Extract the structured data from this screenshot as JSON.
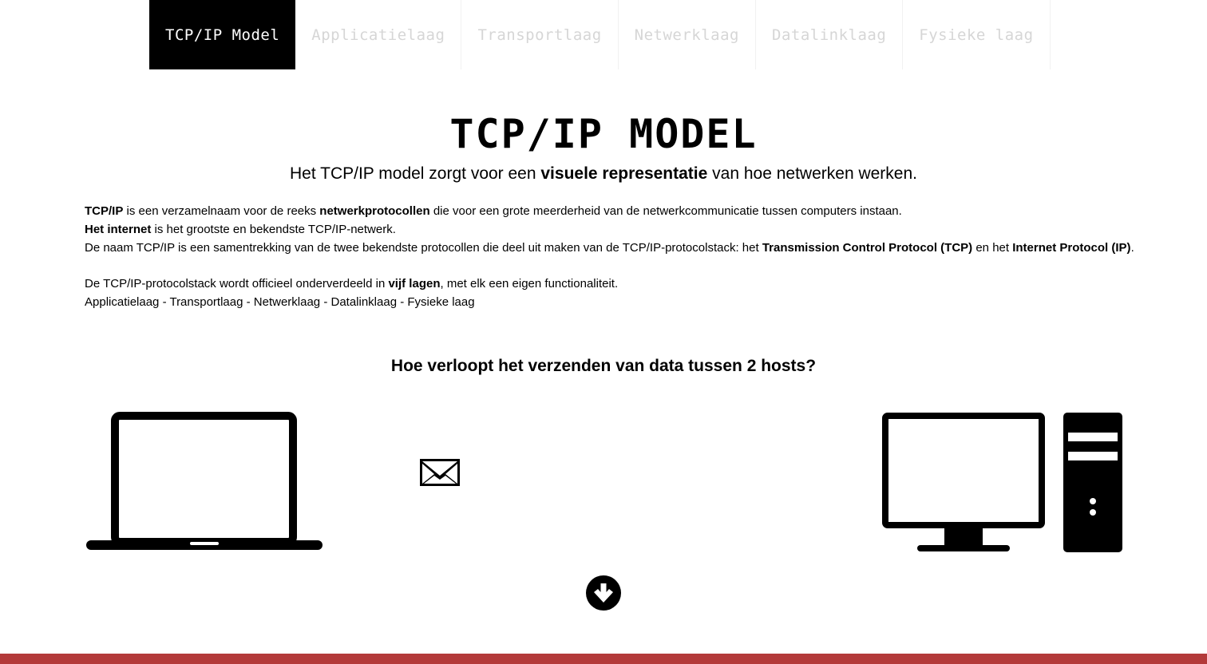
{
  "nav": {
    "items": [
      {
        "label": "TCP/IP Model",
        "active": true
      },
      {
        "label": "Applicatielaag",
        "active": false
      },
      {
        "label": "Transportlaag",
        "active": false
      },
      {
        "label": "Netwerklaag",
        "active": false
      },
      {
        "label": "Datalinklaag",
        "active": false
      },
      {
        "label": "Fysieke laag",
        "active": false
      }
    ]
  },
  "hero": {
    "title": "TCP/IP MODEL",
    "sub_pre": "Het TCP/IP model zorgt voor een ",
    "sub_bold": "visuele representatie",
    "sub_post": " van hoe netwerken werken."
  },
  "intro": {
    "l1_b1": "TCP/IP",
    "l1_t1": " is een verzamelnaam voor de reeks ",
    "l1_b2": "netwerkprotocollen",
    "l1_t2": " die voor een grote meerderheid van de netwerkcommunicatie tussen computers instaan.",
    "l2_b1": "Het internet",
    "l2_t1": " is het grootste en bekendste TCP/IP-netwerk.",
    "l3_t1": "De naam TCP/IP is een samentrekking van de twee bekendste protocollen die deel uit maken van de TCP/IP-protocolstack: het ",
    "l3_b1": "Transmission Control Protocol (TCP)",
    "l3_t2": " en het ",
    "l3_b2": "Internet Protocol (IP)",
    "l3_t3": "."
  },
  "layers": {
    "l1_t1": "De TCP/IP-protocolstack wordt officieel onderverdeeld in ",
    "l1_b1": "vijf lagen",
    "l1_t2": ", met elk een eigen functionaliteit.",
    "l2": "Applicatielaag - Transportlaag - Netwerklaag - Datalinklaag - Fysieke laag"
  },
  "question": "Hoe verloopt het verzenden van data tussen 2 hosts?",
  "icons": {
    "laptop": "laptop-icon",
    "envelope": "envelope-icon",
    "desktop": "desktop-computer-icon",
    "scroll_down": "arrow-down-circle-icon"
  },
  "colors": {
    "footer_bar": "#b33a3a",
    "nav_active_bg": "#000000",
    "nav_inactive_text": "#d6d6d6"
  }
}
